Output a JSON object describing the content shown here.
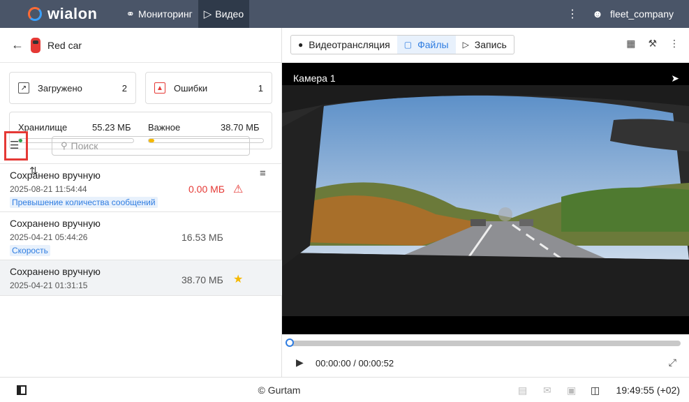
{
  "topbar": {
    "logo_text": "wialon",
    "nav": [
      {
        "label": "Мониторинг",
        "icon": "globe-icon"
      },
      {
        "label": "Видео",
        "icon": "video-camera-icon"
      }
    ],
    "user": "fleet_company"
  },
  "unit": {
    "name": "Red car"
  },
  "stats": {
    "uploaded_label": "Загружено",
    "uploaded_count": "2",
    "errors_label": "Ошибки",
    "errors_count": "1"
  },
  "storage": {
    "storage_label": "Хранилище",
    "storage_value": "55.23 МБ",
    "storage_fill": 0.01,
    "important_label": "Важное",
    "important_value": "38.70 МБ",
    "important_fill": 0.05
  },
  "search": {
    "placeholder": "Поиск"
  },
  "files": [
    {
      "title": "Сохранено вручную",
      "date": "2025-08-21 11:54:44",
      "tag": "Превышение количества сообщений",
      "size": "0.00 МБ",
      "status": "error"
    },
    {
      "title": "Сохранено вручную",
      "date": "2025-04-21 05:44:26",
      "tag": "Скорость",
      "size": "16.53 МБ",
      "status": ""
    },
    {
      "title": "Сохранено вручную",
      "date": "2025-04-21 01:31:15",
      "tag": "",
      "size": "38.70 МБ",
      "status": "star"
    }
  ],
  "video_tabs": {
    "live": "Видеотрансляция",
    "files": "Файлы",
    "record": "Запись"
  },
  "camera": {
    "label": "Камера 1"
  },
  "player": {
    "time": "00:00:00 / 00:00:52",
    "progress": 0.0
  },
  "footer": {
    "copyright": "© Gurtam",
    "clock": "19:49:55 (+02)"
  },
  "colors": {
    "accent": "#2f7de1",
    "error": "#e53935",
    "warning": "#f5b800",
    "ok": "#2e9e4a",
    "topbar": "#4a5568"
  }
}
